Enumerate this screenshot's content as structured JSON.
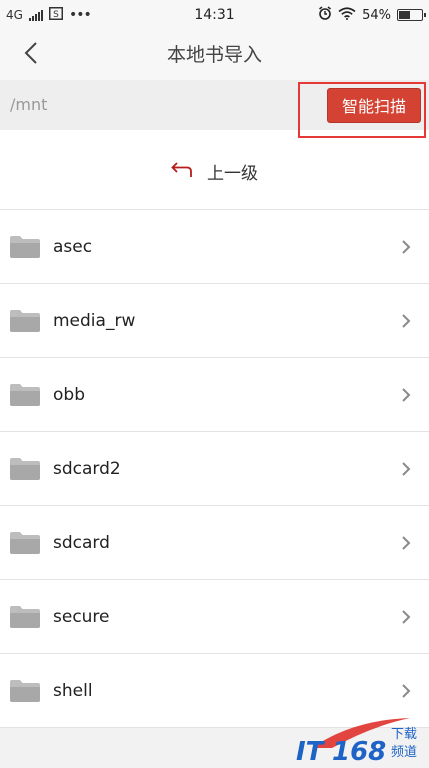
{
  "status_bar": {
    "network": "4G",
    "sim_icon": "sim-card-icon",
    "more": "•••",
    "time": "14:31",
    "battery_percent": "54%",
    "battery_level": 0.54
  },
  "header": {
    "title": "本地书导入",
    "back_icon": "chevron-left-icon"
  },
  "path_bar": {
    "path": "/mnt",
    "scan_label": "智能扫描"
  },
  "up_level": {
    "label": "上一级",
    "icon": "return-arrow-icon"
  },
  "folders": [
    {
      "name": "asec"
    },
    {
      "name": "media_rw"
    },
    {
      "name": "obb"
    },
    {
      "name": "sdcard2"
    },
    {
      "name": "sdcard"
    },
    {
      "name": "secure"
    },
    {
      "name": "shell"
    }
  ],
  "watermark": {
    "logo_text": "IT168",
    "line1": "下载",
    "line2": "频道"
  },
  "colors": {
    "accent": "#d34232",
    "highlight": "#e53935",
    "up_arrow": "#b71c1c"
  }
}
